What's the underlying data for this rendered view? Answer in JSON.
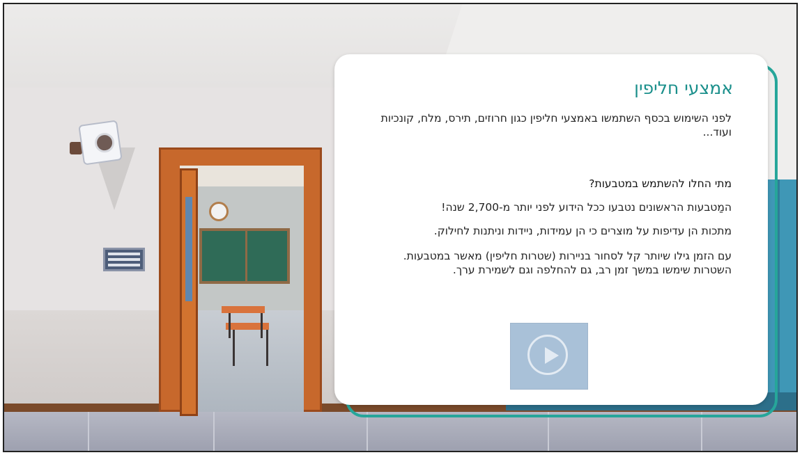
{
  "card": {
    "title": "אמצעי חליפין",
    "intro": "לפני השימוש בכסף השתמשו באמצעי חליפין כגון חרוזים, תירס, מלח, קונכיות ועוד...",
    "question": "מתי החלו להשתמש במטבעות?",
    "paragraphs": [
      "המַטבעות הראשונים נטבעו ככל הידוע לפני יותר מ-2,700 שנה!",
      "מתכות הן עדיפות על מוצרים כי הן עמידות, ניידות וניתנות לחילוק.",
      "עם הזמן גילו שיותר קל לסחור בניירות (שטרות חליפין) מאשר במטבעות.",
      "השטרות שימשו במשך זמן רב, גם להחלפה וגם לשמירת ערך."
    ]
  },
  "video": {
    "icon": "play-icon"
  },
  "colors": {
    "title": "#1a8f8b",
    "accent": "#26a69a",
    "thumb": "#a9c1d8"
  }
}
